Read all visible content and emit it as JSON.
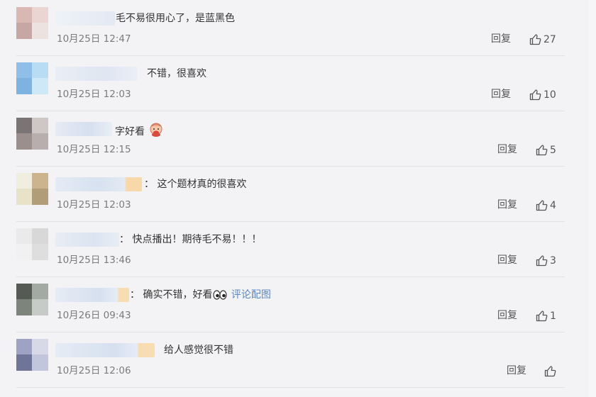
{
  "comments": [
    {
      "text": "毛不易很用心了，是蓝黑色",
      "time": "10月25日 12:47",
      "reply": "回复",
      "likes": "27",
      "avatar": [
        "#d9b8b4",
        "#e9d6d2",
        "#c7a7a3",
        "#ece3e1"
      ]
    },
    {
      "text": "不错，很喜欢",
      "time": "10月25日 12:03",
      "reply": "回复",
      "likes": "10",
      "avatar": [
        "#8fbfe6",
        "#b9dcf5",
        "#7fb3df",
        "#cfe8f8"
      ]
    },
    {
      "text": "字好看",
      "time": "10月25日 12:15",
      "reply": "回复",
      "likes": "5",
      "avatar": [
        "#7b7474",
        "#cfc7c6",
        "#9a8f8d",
        "#b8aeae"
      ]
    },
    {
      "text": "：  这个题材真的很喜欢",
      "time": "10月25日 12:03",
      "reply": "回复",
      "likes": "4",
      "avatar": [
        "#efeedf",
        "#cbb48e",
        "#e7e2c8",
        "#b19e78"
      ]
    },
    {
      "text": "：  快点播出！期待毛不易！！！",
      "time": "10月25日 13:46",
      "reply": "回复",
      "likes": "3",
      "avatar": [
        "#eaeaea",
        "#d8d8d8",
        "#f1f1f1",
        "#dedede"
      ]
    },
    {
      "text": "：  确实不错，好看",
      "link": "评论配图",
      "time": "10月26日 09:43",
      "reply": "回复",
      "likes": "1",
      "avatar": [
        "#555a55",
        "#a3aaa3",
        "#7c847c",
        "#c7cbc7"
      ]
    },
    {
      "text": "给人感觉很不错",
      "time": "10月25日 12:06",
      "reply": "回复",
      "likes": "",
      "avatar": [
        "#9ea3c4",
        "#d7d9e6",
        "#6f7499",
        "#c2c6dc"
      ]
    }
  ],
  "icons": {
    "like": "thumbs-up-icon",
    "emoji_baby": "baby-emoji-icon",
    "emoji_eyes": "eyes-emoji-icon"
  }
}
